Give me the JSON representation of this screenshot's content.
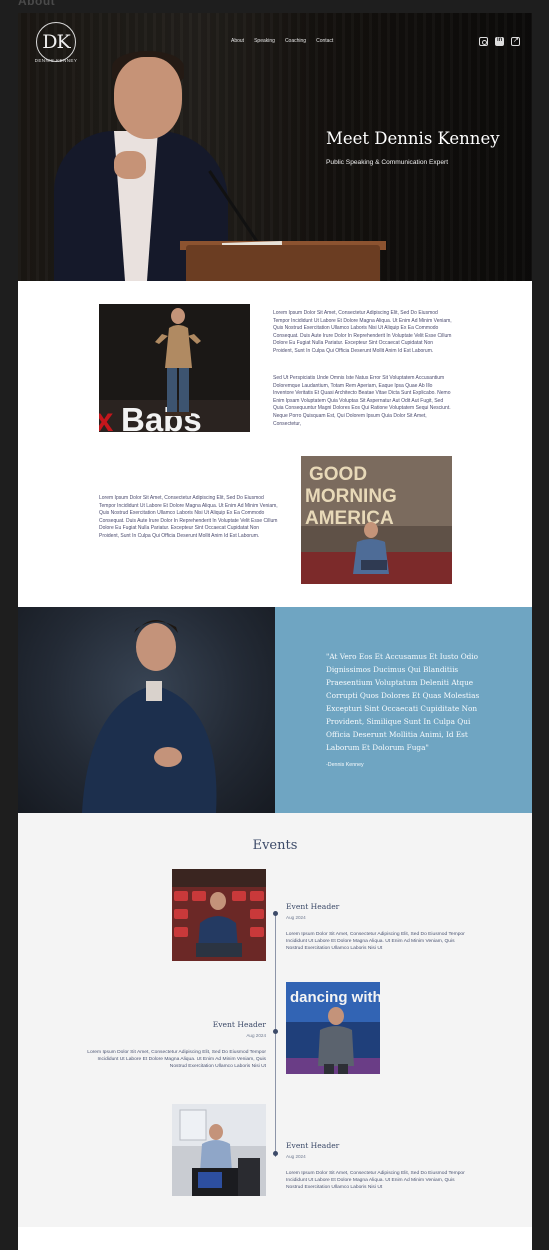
{
  "page_label": "About",
  "header": {
    "logo_mark": "DK",
    "logo_name": "DENNIS KENNEY",
    "nav": [
      "About",
      "Speaking",
      "Coaching",
      "Contact"
    ],
    "social_icons": [
      "instagram-icon",
      "linkedin-icon",
      "external-link-icon"
    ]
  },
  "hero": {
    "title": "Meet Dennis Kenney",
    "subtitle": "Public Speaking & Communication Expert"
  },
  "about": {
    "para1": "Lorem Ipsum Dolor Sit Amet, Consectetur Adipiscing Elit, Sed Do Eiusmod Tempor Incididunt Ut Labore Et Dolore Magna Aliqua. Ut Enim Ad Minim Veniam, Quis Nostrud Exercitation Ullamco Laboris Nisi Ut Aliquip Ex Ea Commodo Consequat. Duis Aute Irure Dolor In Reprehenderit In Voluptate Velit Esse Cillum Dolore Eu Fugiat Nulla Pariatur. Excepteur Sint Occaecat Cupidatat Non Proident, Sunt In Culpa Qui Officia Deserunt Mollit Anim Id Est Laborum.",
    "para2": "Sed Ut Perspiciatis Unde Omnis Iste Natus Error Sit Voluptatem Accusantium Doloremque Laudantium, Totam Rem Aperiam, Eaque Ipsa Quae Ab Illo Inventore Veritatis Et Quasi Architecto Beatae Vitae Dicta Sunt Explicabo. Nemo Enim Ipsam Voluptatem Quia Voluptas Sit Aspernatur Aut Odit Aut Fugit, Sed Quia Consequuntur Magni Dolores Eos Qui Ratione Voluptatem Sequi Nesciunt. Neque Porro Quisquam Est, Qui Dolorem Ipsum Quia Dolor Sit Amet, Consectetur,",
    "para3": "Lorem Ipsum Dolor Sit Amet, Consectetur Adipiscing Elit, Sed Do Eiusmod Tempor Incididunt Ut Labore Et Dolore Magna Aliqua. Ut Enim Ad Minim Veniam, Quis Nostrud Exercitation Ullamco Laboris Nisi Ut Aliquip Ex Ea Commodo Consequat. Duis Aute Irure Dolor In Reprehenderit In Voluptate Velit Esse Cillum Dolore Eu Fugiat Nulla Pariatur. Excepteur Sint Occaecat Cupidatat Non Proident, Sunt In Culpa Qui Officia Deserunt Mollit Anim Id Est Laborum.",
    "img1_sign": "xBabs",
    "img2_sign": "GOOD MORNING AMERICA"
  },
  "quote": {
    "text": "\"At Vero Eos Et Accusamus Et Iusto Odio Dignissimos Ducimus Qui Blanditiis Praesentium Voluptatum Deleniti Atque Corrupti Quos Dolores Et Quas Molestias Excepturi Sint Occaecati Cupiditate Non Provident, Similique Sunt In Culpa Qui Officia Deserunt Mollitia Animi, Id Est Laborum Et Dolorum Fuga\"",
    "author": "-Dennis Kenney",
    "accent_color": "#6fa5c2"
  },
  "events": {
    "title": "Events",
    "items": [
      {
        "header": "Event Header",
        "date": "Aug 2024",
        "body": "Lorem Ipsum Dolor Sit Amet, Consectetur Adipiscing Elit, Sed Do Eiusmod Tempor Incididunt Ut Labore Et Dolore Magna Aliqua. Ut Enim Ad Minim Veniam, Quis Nostrud Exercitation Ullamco Laboris Nisi Ut"
      },
      {
        "header": "Event Header",
        "date": "Aug 2024",
        "body": "Lorem Ipsum Dolor Sit Amet, Consectetur Adipiscing Elit, Sed Do Eiusmod Tempor Incididunt Ut Labore Et Dolore Magna Aliqua. Ut Enim Ad Minim Veniam, Quis Nostrud Exercitation Ullamco Laboris Nisi Ut",
        "img_sign": "dancing with the stars"
      },
      {
        "header": "Event Header",
        "date": "Aug 2024",
        "body": "Lorem Ipsum Dolor Sit Amet, Consectetur Adipiscing Elit, Sed Do Eiusmod Tempor Incididunt Ut Labore Et Dolore Magna Aliqua. Ut Enim Ad Minim Veniam, Quis Nostrud Exercitation Ullamco Laboris Nisi Ut"
      }
    ]
  }
}
